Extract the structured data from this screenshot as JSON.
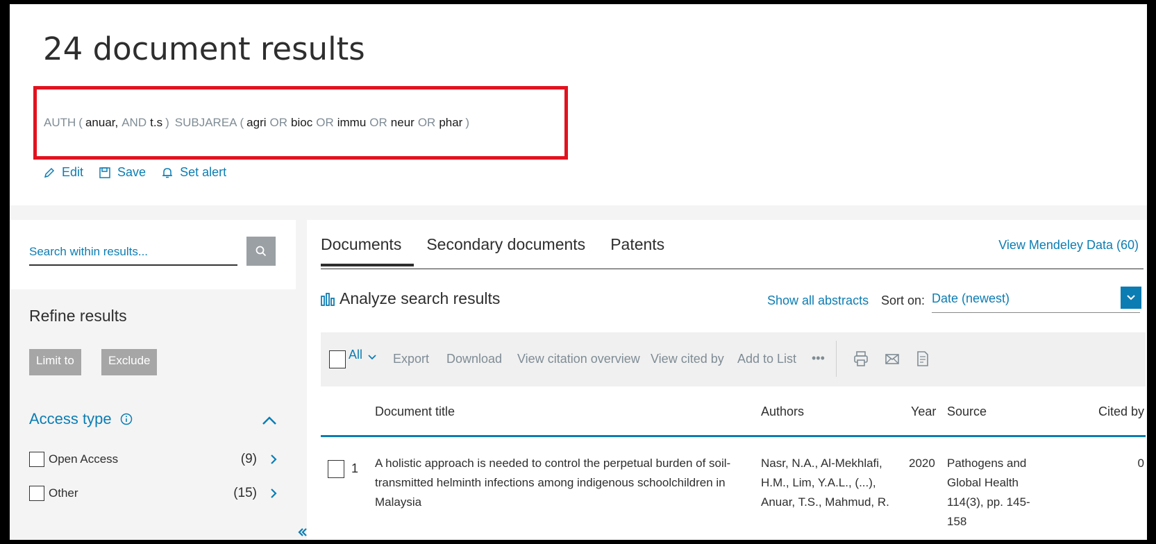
{
  "header": {
    "title": "24 document results",
    "query": {
      "auth_label": "AUTH",
      "auth_term1": "anuar,",
      "and_op": "AND",
      "auth_term2": "t.s",
      "subj_label": "SUBJAREA",
      "subj_terms": [
        "agri",
        "bioc",
        "immu",
        "neur",
        "phar"
      ],
      "or_op": "OR",
      "open_paren": "(",
      "close_paren": ")"
    },
    "actions": {
      "edit": "Edit",
      "save": "Save",
      "set_alert": "Set alert"
    }
  },
  "sidebar": {
    "search_placeholder": "Search within results...",
    "refine_title": "Refine results",
    "limit_to": "Limit to",
    "exclude": "Exclude",
    "access_type": {
      "title": "Access type",
      "items": [
        {
          "label": "Open Access",
          "count": "(9)"
        },
        {
          "label": "Other",
          "count": "(15)"
        }
      ]
    }
  },
  "main": {
    "tabs": [
      {
        "label": "Documents",
        "active": true
      },
      {
        "label": "Secondary documents",
        "active": false
      },
      {
        "label": "Patents",
        "active": false
      }
    ],
    "mendeley_link": "View Mendeley Data (60)",
    "analyze": "Analyze search results",
    "show_abstracts": "Show all abstracts",
    "sort_label": "Sort on:",
    "sort_value": "Date (newest)",
    "toolbar": {
      "all": "All",
      "actions": [
        "Export",
        "Download",
        "View citation overview",
        "View cited by",
        "Add to List",
        "•••"
      ]
    },
    "columns": {
      "title": "Document title",
      "authors": "Authors",
      "year": "Year",
      "source": "Source",
      "cited_by": "Cited by"
    },
    "rows": [
      {
        "num": "1",
        "title": "A holistic approach is needed to control the perpetual burden of soil-transmitted helminth infections among indigenous schoolchildren in Malaysia",
        "authors": "Nasr, N.A., Al-Mekhlafi, H.M., Lim, Y.A.L., (...), Anuar, T.S., Mahmud, R.",
        "year": "2020",
        "source": "Pathogens and Global Health 114(3), pp. 145-158",
        "cited_by": "0"
      }
    ]
  },
  "colors": {
    "link": "#0c7db3",
    "highlight_border": "#e2121f"
  }
}
